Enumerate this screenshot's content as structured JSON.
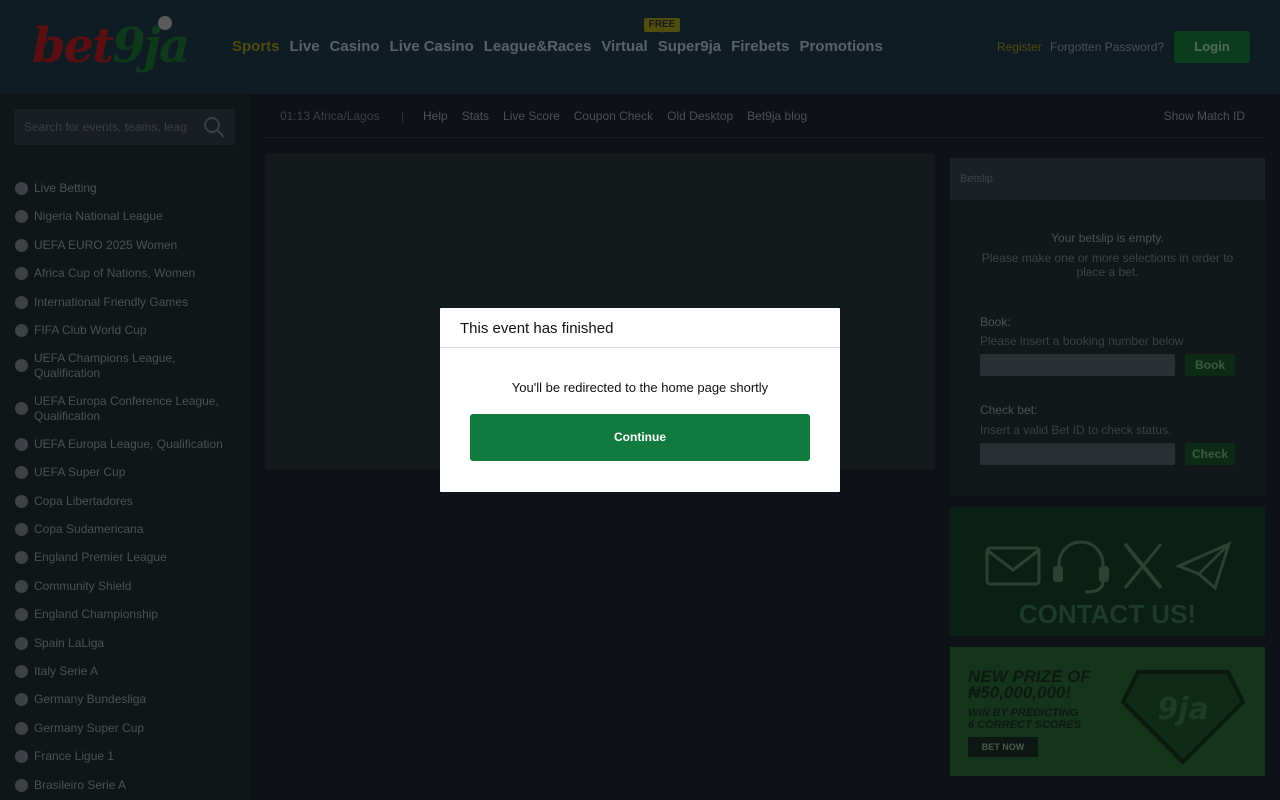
{
  "header": {
    "logo_text_a": "bet",
    "logo_text_b": "9ja",
    "nav": [
      "Sports",
      "Live",
      "Casino",
      "Live Casino",
      "League&Races",
      "Virtual",
      "Super9ja",
      "Firebets",
      "Promotions"
    ],
    "free_badge": "FREE",
    "register": "Register",
    "forgot": "Forgotten Password?",
    "login": "Login"
  },
  "sidebar": {
    "search_placeholder": "Search for events, teams, leag",
    "leagues": [
      "Live Betting",
      "Nigeria National League",
      "UEFA EURO 2025 Women",
      "Africa Cup of Nations, Women",
      "International Friendly Games",
      "FIFA Club World Cup",
      "UEFA Champions League, Qualification",
      "UEFA Europa Conference League, Qualification",
      "UEFA Europa League, Qualification",
      "UEFA Super Cup",
      "Copa Libertadores",
      "Copa Sudamericana",
      "England Premier League",
      "Community Shield",
      "England Championship",
      "Spain LaLiga",
      "Italy Serie A",
      "Germany Bundesliga",
      "Germany Super Cup",
      "France Ligue 1",
      "Brasileiro Serie A"
    ]
  },
  "subnav": {
    "time": "01:13 Africa/Lagos",
    "separator": "|",
    "links": [
      "Help",
      "Stats",
      "Live Score",
      "Coupon Check",
      "Old Desktop",
      "Bet9ja blog"
    ],
    "show_match_id": "Show Match ID"
  },
  "betslip": {
    "title": "Betslip",
    "empty_title": "Your betslip is empty.",
    "empty_text": "Please make one or more selections in order to place a bet.",
    "book_label": "Book:",
    "book_sub": "Please insert a booking number below",
    "book_button": "Book",
    "check_label": "Check bet:",
    "check_sub": "Insert a valid Bet ID to check status.",
    "check_button": "Check"
  },
  "contact": {
    "title": "CONTACT US!",
    "icons": [
      "mail-icon",
      "headset-icon",
      "x-icon",
      "telegram-icon"
    ]
  },
  "promo": {
    "line1": "NEW PRIZE OF",
    "line2": "₦50,000,000!",
    "line3": "WIN BY PREDICTING",
    "line4": "6 CORRECT SCORES",
    "button": "BET NOW",
    "logo": "9ja"
  },
  "modal": {
    "title": "This event has finished",
    "message": "You'll be redirected to the home page shortly",
    "button": "Continue"
  },
  "colors": {
    "accent_green": "#117a3e",
    "overlay": "#0e1116",
    "modal_bg": "#ffffff"
  }
}
